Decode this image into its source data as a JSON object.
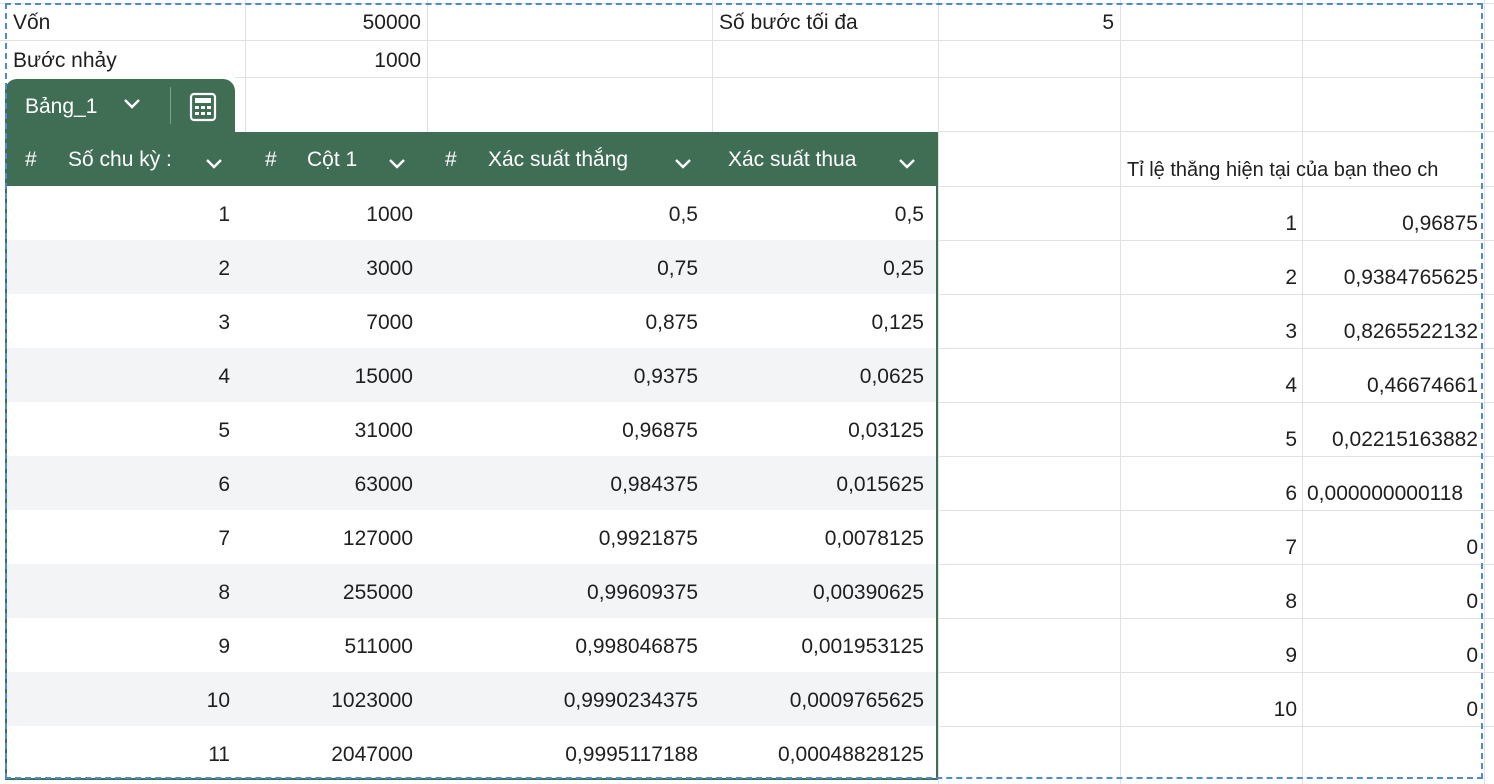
{
  "top_cells": {
    "von_label": "Vốn",
    "von_value": "50000",
    "buoc_nhay_label": "Bước nhảy",
    "buoc_nhay_value": "1000",
    "so_buoc_label": "Số bước tối đa",
    "so_buoc_value": "5"
  },
  "table": {
    "tab_name": "Bảng_1",
    "columns": [
      {
        "label": "Số chu kỳ :",
        "type_icon": "#"
      },
      {
        "label": "Cột 1",
        "type_icon": "#"
      },
      {
        "label": "Xác suất thắng",
        "type_icon": "#"
      },
      {
        "label": "Xác suất thua",
        "type_icon": ""
      }
    ],
    "rows": [
      [
        "1",
        "1000",
        "0,5",
        "0,5"
      ],
      [
        "2",
        "3000",
        "0,75",
        "0,25"
      ],
      [
        "3",
        "7000",
        "0,875",
        "0,125"
      ],
      [
        "4",
        "15000",
        "0,9375",
        "0,0625"
      ],
      [
        "5",
        "31000",
        "0,96875",
        "0,03125"
      ],
      [
        "6",
        "63000",
        "0,984375",
        "0,015625"
      ],
      [
        "7",
        "127000",
        "0,9921875",
        "0,0078125"
      ],
      [
        "8",
        "255000",
        "0,99609375",
        "0,00390625"
      ],
      [
        "9",
        "511000",
        "0,998046875",
        "0,001953125"
      ],
      [
        "10",
        "1023000",
        "0,9990234375",
        "0,0009765625"
      ],
      [
        "11",
        "2047000",
        "0,9995117188",
        "0,00048828125"
      ]
    ]
  },
  "right_block": {
    "title": "Tỉ lệ thắng hiện tại của bạn theo ch",
    "rows": [
      [
        "1",
        "0,96875"
      ],
      [
        "2",
        "0,9384765625"
      ],
      [
        "3",
        "0,8265522132"
      ],
      [
        "4",
        "0,46674661"
      ],
      [
        "5",
        "0,02215163882"
      ],
      [
        "6",
        "0,000000000118"
      ],
      [
        "7",
        "0"
      ],
      [
        "8",
        "0"
      ],
      [
        "9",
        "0"
      ],
      [
        "10",
        "0"
      ]
    ]
  },
  "colors": {
    "table_header": "#3f6e55",
    "selection": "#4a8ad9",
    "gridline": "#e1e1e1"
  }
}
